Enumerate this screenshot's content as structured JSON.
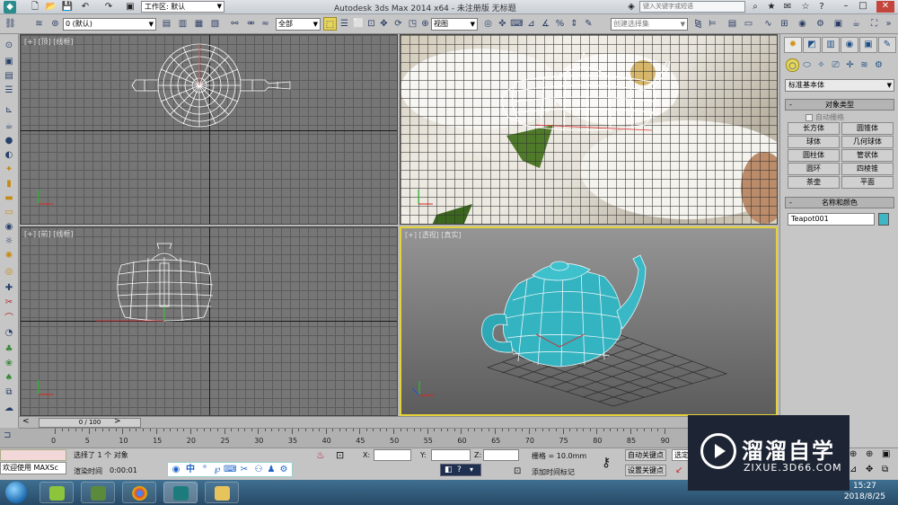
{
  "titlebar": {
    "app_title": "Autodesk 3ds Max  2014 x64   - 未注册版   无标题",
    "workspace_label": "工作区: 默认",
    "search_placeholder": "键入关键字或短语"
  },
  "toolbar": {
    "layer_value": "0 (默认)",
    "filter_value": "全部",
    "refcoord_value": "视图",
    "selection_set_placeholder": "创建选择集"
  },
  "viewports": {
    "top": {
      "label": "[+] [顶] [线框]"
    },
    "perspective_photo": {
      "label": ""
    },
    "front": {
      "label": "[+] [前] [线框]"
    },
    "perspective": {
      "label": "[+] [透视] [真实]"
    }
  },
  "command_panel": {
    "category_dropdown": "标准基本体",
    "object_type_header": "对象类型",
    "autogrid_label": "自动栅格",
    "object_buttons": [
      "长方体",
      "圆锥体",
      "球体",
      "几何球体",
      "圆柱体",
      "管状体",
      "圆环",
      "四棱锥",
      "茶壶",
      "平面"
    ],
    "name_color_header": "名称和颜色",
    "object_name": "Teapot001",
    "object_color": "#3fb6c4"
  },
  "timeline": {
    "slider_label": "0 / 100",
    "frame_ticks": [
      "0",
      "5",
      "10",
      "15",
      "20",
      "25",
      "30",
      "35",
      "40",
      "45",
      "50",
      "55",
      "60",
      "65",
      "70",
      "75",
      "80",
      "85",
      "90"
    ]
  },
  "status": {
    "maxscript_prompt": "欢迎使用 MAXSc",
    "selected_text": "选择了 1 个 对象",
    "render_time_label": "渲染时间",
    "render_time_value": "0:00:01",
    "x_label": "X:",
    "y_label": "Y:",
    "z_label": "Z:",
    "grid_text": "栅格 = 10.0mm",
    "auto_key_label": "自动关键点",
    "set_key_label": "设置关键点",
    "add_time_tag": "添加时间标记",
    "selected_mode": "选定"
  },
  "taskbar": {
    "time": "15:27",
    "date": "2018/8/25"
  },
  "watermark": {
    "title": "溜溜自学",
    "subtitle": "ZIXUE.3D66.COM"
  },
  "icons": {
    "accent": "#3fb6c4",
    "selection_highlight": "#e3d23a"
  }
}
